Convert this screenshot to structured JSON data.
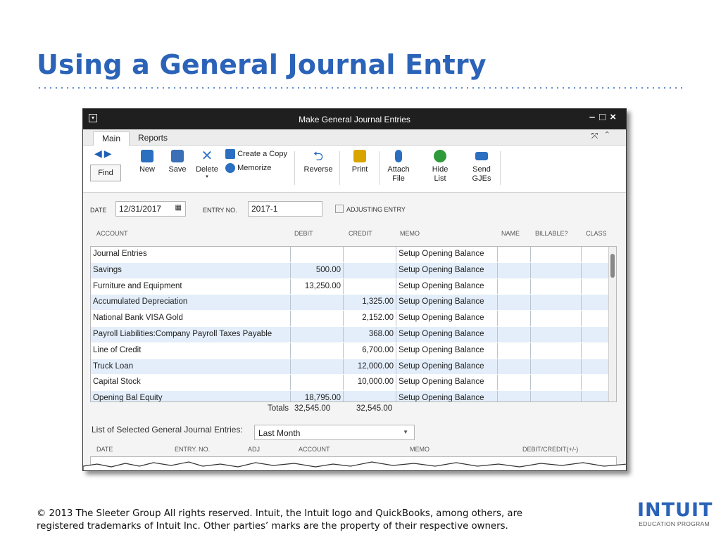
{
  "slide": {
    "title": "Using a General Journal Entry",
    "footer_line1": "© 2013 The Sleeter Group  All rights reserved. Intuit, the Intuit logo and QuickBooks, among others, are",
    "footer_line2": "registered trademarks of Intuit Inc.  Other parties’ marks are the property of their respective owners.",
    "logo_word": "INTUIT",
    "logo_sub": "EDUCATION PROGRAM"
  },
  "window": {
    "title": "Make General Journal Entries",
    "sysmenu": "▾",
    "controls": "–□×"
  },
  "tabs": {
    "main": "Main",
    "reports": "Reports",
    "right_icons": "⤧⌃"
  },
  "toolbar": {
    "find": "Find",
    "new": "New",
    "save": "Save",
    "delete": "Delete",
    "create_copy": "Create a Copy",
    "memorize": "Memorize",
    "reverse": "Reverse",
    "print": "Print",
    "attach_1": "Attach",
    "attach_2": "File",
    "hide_1": "Hide",
    "hide_2": "List",
    "send_1": "Send",
    "send_2": "GJEs"
  },
  "form": {
    "date_label": "DATE",
    "date_value": "12/31/2017",
    "entry_label": "ENTRY NO.",
    "entry_value": "2017-1",
    "adjusting_label": "ADJUSTING ENTRY"
  },
  "grid": {
    "headers": {
      "account": "ACCOUNT",
      "debit": "DEBIT",
      "credit": "CREDIT",
      "memo": "MEMO",
      "name": "NAME",
      "billable": "BILLABLE?",
      "class": "CLASS"
    },
    "rows": [
      {
        "account": "Journal Entries",
        "debit": "",
        "credit": "",
        "memo": "Setup Opening Balance"
      },
      {
        "account": "Savings",
        "debit": "500.00",
        "credit": "",
        "memo": "Setup Opening Balance"
      },
      {
        "account": "Furniture and Equipment",
        "debit": "13,250.00",
        "credit": "",
        "memo": "Setup Opening Balance"
      },
      {
        "account": "Accumulated Depreciation",
        "debit": "",
        "credit": "1,325.00",
        "memo": "Setup Opening Balance"
      },
      {
        "account": "National Bank VISA Gold",
        "debit": "",
        "credit": "2,152.00",
        "memo": "Setup Opening Balance"
      },
      {
        "account": "Payroll Liabilities:Company Payroll Taxes Payable",
        "debit": "",
        "credit": "368.00",
        "memo": "Setup Opening Balance"
      },
      {
        "account": "Line of Credit",
        "debit": "",
        "credit": "6,700.00",
        "memo": "Setup Opening Balance"
      },
      {
        "account": "Truck Loan",
        "debit": "",
        "credit": "12,000.00",
        "memo": "Setup Opening Balance"
      },
      {
        "account": "Capital Stock",
        "debit": "",
        "credit": "10,000.00",
        "memo": "Setup Opening Balance"
      },
      {
        "account": "Opening Bal Equity",
        "debit": "18,795.00",
        "credit": "",
        "memo": "Setup Opening Balance"
      }
    ],
    "totals_label": "Totals",
    "total_debit": "32,545.00",
    "total_credit": "32,545.00"
  },
  "list": {
    "label": "List of Selected General Journal Entries:",
    "filter_value": "Last Month",
    "headers": {
      "date": "DATE",
      "entry_no": "ENTRY. NO.",
      "adj": "ADJ",
      "account": "ACCOUNT",
      "memo": "MEMO",
      "debit_credit": "DEBIT/CREDIT(+/-)"
    }
  },
  "colors": {
    "title_blue": "#2a63b8",
    "row_alt": "#e3eefa",
    "titlebar": "#1f1f1f"
  }
}
